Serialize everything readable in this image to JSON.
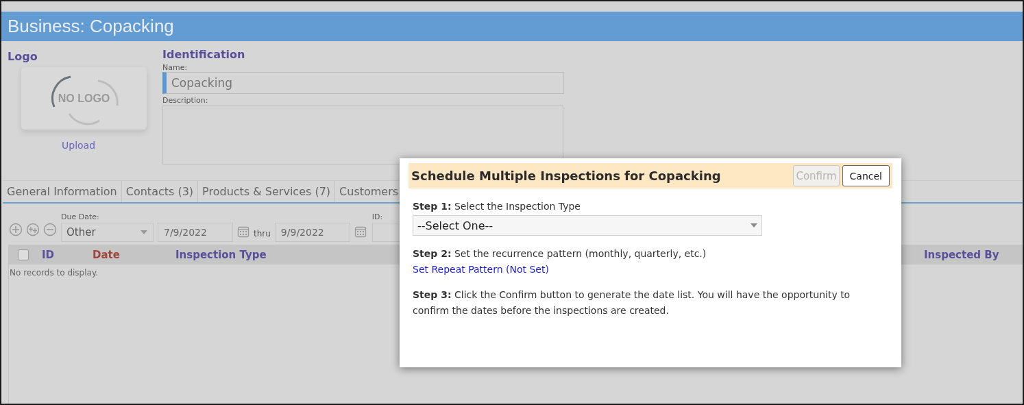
{
  "page_title": "Business: Copacking",
  "logo": {
    "heading": "Logo",
    "image_text": "NO LOGO",
    "upload": "Upload"
  },
  "identification": {
    "heading": "Identification",
    "name_label": "Name:",
    "name_value": "Copacking",
    "description_label": "Description:"
  },
  "tabs": [
    {
      "label": "General Information",
      "selected": false
    },
    {
      "label": "Contacts (3)",
      "selected": false
    },
    {
      "label": "Products & Services (7)",
      "selected": false
    },
    {
      "label": "Customers",
      "selected": false
    }
  ],
  "filter": {
    "due_date_label": "Due Date:",
    "due_date_option": "Other",
    "from": "7/9/2022",
    "thru": "thru",
    "to": "9/9/2022",
    "id_label": "ID:"
  },
  "grid": {
    "select_all_checked": false,
    "columns": [
      {
        "label": "ID",
        "color": "#5a4f9a"
      },
      {
        "label": "Date",
        "color": "#a0453e"
      },
      {
        "label": "Inspection Type",
        "color": "#5a4f9a"
      },
      {
        "label": "Inspected By",
        "color": "#5a4f9a"
      }
    ],
    "empty": "No records to display."
  },
  "dialog": {
    "title": "Schedule Multiple Inspections for Copacking",
    "buttons": [
      {
        "label": "Confirm",
        "disabled": true
      },
      {
        "label": "Cancel",
        "disabled": false
      }
    ],
    "steps": [
      {
        "kind": "select",
        "lead": "Step 1:",
        "text": "Select the Inspection Type",
        "value": "--Select One--"
      },
      {
        "kind": "link",
        "lead": "Step 2:",
        "text": "Set the recurrence pattern (monthly, quarterly, etc.)",
        "value": "Set Repeat Pattern (Not Set)"
      },
      {
        "kind": "text",
        "lead": "Step 3:",
        "text": "Click the Confirm button to generate the date list. You will have the opportunity to confirm the dates before the inspections are created."
      }
    ]
  }
}
